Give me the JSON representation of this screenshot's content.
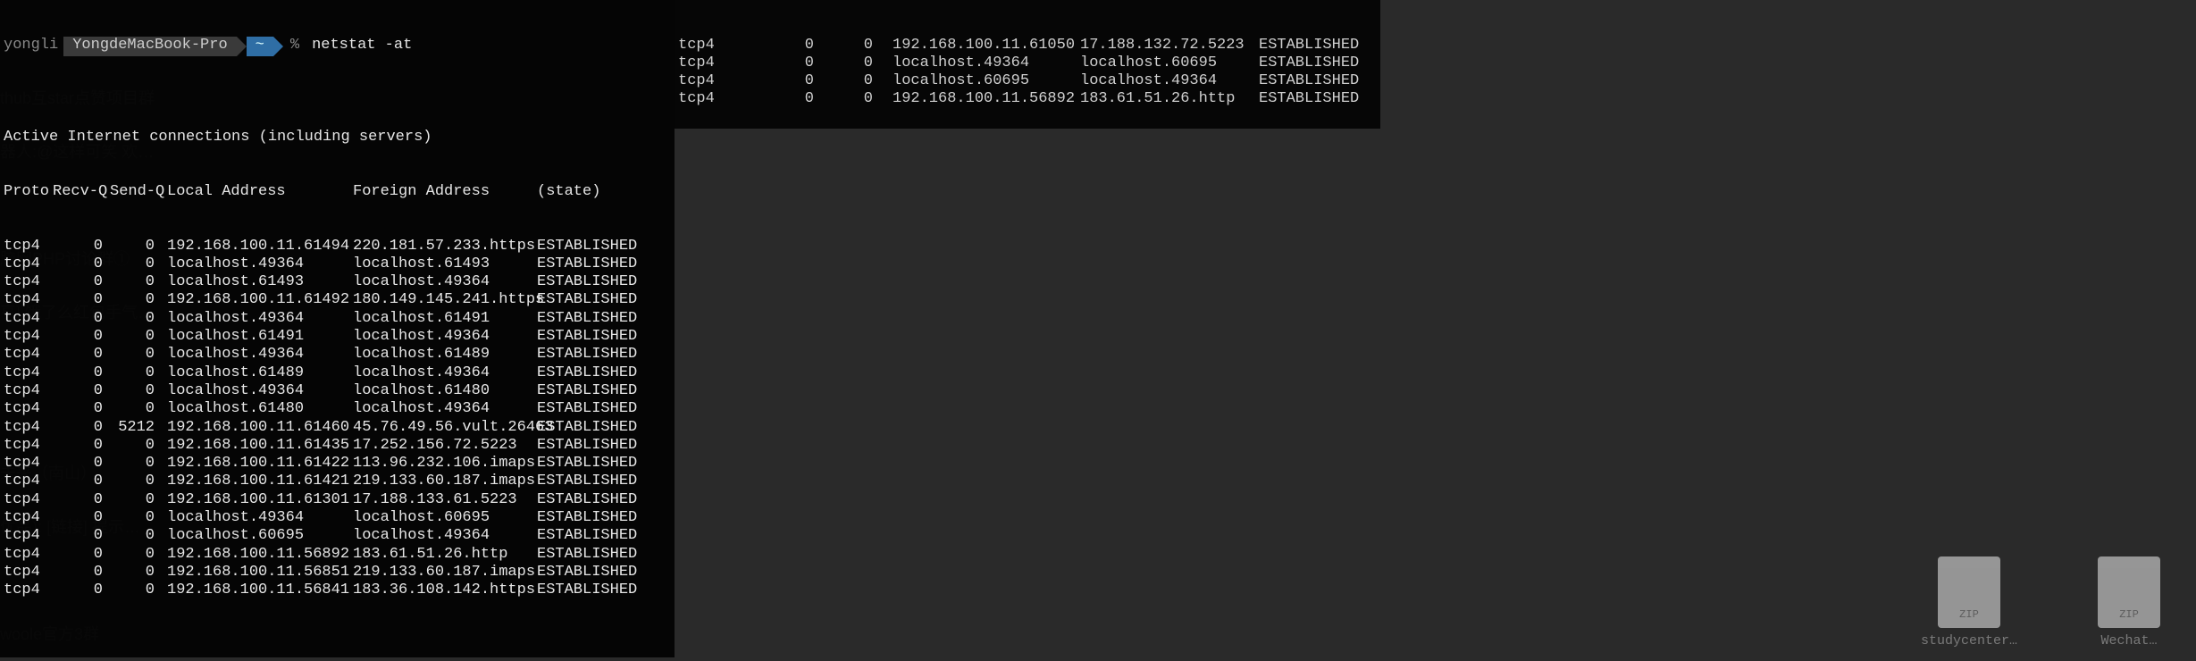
{
  "prompt": {
    "user": "yongli",
    "host": "YongdeMacBook-Pro",
    "path": "~",
    "symbol": "%",
    "command": "netstat -at"
  },
  "header_line": "Active Internet connections (including servers)",
  "columns": {
    "proto": "Proto",
    "recv": "Recv-Q",
    "send": "Send-Q",
    "local": "Local Address",
    "foreign": "Foreign Address",
    "state": "(state)"
  },
  "rows": [
    {
      "proto": "tcp4",
      "recv": "0",
      "send": "0",
      "local": "192.168.100.11.61494",
      "foreign": "220.181.57.233.https",
      "state": "ESTABLISHED"
    },
    {
      "proto": "tcp4",
      "recv": "0",
      "send": "0",
      "local": "localhost.49364",
      "foreign": "localhost.61493",
      "state": "ESTABLISHED"
    },
    {
      "proto": "tcp4",
      "recv": "0",
      "send": "0",
      "local": "localhost.61493",
      "foreign": "localhost.49364",
      "state": "ESTABLISHED"
    },
    {
      "proto": "tcp4",
      "recv": "0",
      "send": "0",
      "local": "192.168.100.11.61492",
      "foreign": "180.149.145.241.https",
      "state": "ESTABLISHED"
    },
    {
      "proto": "tcp4",
      "recv": "0",
      "send": "0",
      "local": "localhost.49364",
      "foreign": "localhost.61491",
      "state": "ESTABLISHED"
    },
    {
      "proto": "tcp4",
      "recv": "0",
      "send": "0",
      "local": "localhost.61491",
      "foreign": "localhost.49364",
      "state": "ESTABLISHED"
    },
    {
      "proto": "tcp4",
      "recv": "0",
      "send": "0",
      "local": "localhost.49364",
      "foreign": "localhost.61489",
      "state": "ESTABLISHED"
    },
    {
      "proto": "tcp4",
      "recv": "0",
      "send": "0",
      "local": "localhost.61489",
      "foreign": "localhost.49364",
      "state": "ESTABLISHED"
    },
    {
      "proto": "tcp4",
      "recv": "0",
      "send": "0",
      "local": "localhost.49364",
      "foreign": "localhost.61480",
      "state": "ESTABLISHED"
    },
    {
      "proto": "tcp4",
      "recv": "0",
      "send": "0",
      "local": "localhost.61480",
      "foreign": "localhost.49364",
      "state": "ESTABLISHED"
    },
    {
      "proto": "tcp4",
      "recv": "0",
      "send": "5212",
      "local": "192.168.100.11.61460",
      "foreign": "45.76.49.56.vult.26463",
      "state": "ESTABLISHED"
    },
    {
      "proto": "tcp4",
      "recv": "0",
      "send": "0",
      "local": "192.168.100.11.61435",
      "foreign": "17.252.156.72.5223",
      "state": "ESTABLISHED"
    },
    {
      "proto": "tcp4",
      "recv": "0",
      "send": "0",
      "local": "192.168.100.11.61422",
      "foreign": "113.96.232.106.imaps",
      "state": "ESTABLISHED"
    },
    {
      "proto": "tcp4",
      "recv": "0",
      "send": "0",
      "local": "192.168.100.11.61421",
      "foreign": "219.133.60.187.imaps",
      "state": "ESTABLISHED"
    },
    {
      "proto": "tcp4",
      "recv": "0",
      "send": "0",
      "local": "192.168.100.11.61301",
      "foreign": "17.188.133.61.5223",
      "state": "ESTABLISHED"
    },
    {
      "proto": "tcp4",
      "recv": "0",
      "send": "0",
      "local": "localhost.49364",
      "foreign": "localhost.60695",
      "state": "ESTABLISHED"
    },
    {
      "proto": "tcp4",
      "recv": "0",
      "send": "0",
      "local": "localhost.60695",
      "foreign": "localhost.49364",
      "state": "ESTABLISHED"
    },
    {
      "proto": "tcp4",
      "recv": "0",
      "send": "0",
      "local": "192.168.100.11.56892",
      "foreign": "183.61.51.26.http",
      "state": "ESTABLISHED"
    },
    {
      "proto": "tcp4",
      "recv": "0",
      "send": "0",
      "local": "192.168.100.11.56851",
      "foreign": "219.133.60.187.imaps",
      "state": "ESTABLISHED"
    },
    {
      "proto": "tcp4",
      "recv": "0",
      "send": "0",
      "local": "192.168.100.11.56841",
      "foreign": "183.36.108.142.https",
      "state": "ESTABLISHED"
    }
  ],
  "rows2": [
    {
      "proto": "tcp4",
      "recv": "0",
      "send": "0",
      "local": "192.168.100.11.61050",
      "foreign": "17.188.132.72.5223",
      "state": "ESTABLISHED"
    },
    {
      "proto": "tcp4",
      "recv": "0",
      "send": "0",
      "local": "localhost.49364",
      "foreign": "localhost.60695",
      "state": "ESTABLISHED"
    },
    {
      "proto": "tcp4",
      "recv": "0",
      "send": "0",
      "local": "localhost.60695",
      "foreign": "localhost.49364",
      "state": "ESTABLISHED"
    },
    {
      "proto": "tcp4",
      "recv": "0",
      "send": "0",
      "local": "192.168.100.11.56892",
      "foreign": "183.61.51.26.http",
      "state": "ESTABLISHED"
    }
  ],
  "bg_chat_lines": [
    "thub互star点赞项目群",
    "器人:@这样可笑 欢…",
    "",
    "脑网PHP讨论群①",
    "亨] 饿了么红包手气…",
    "",
    "",
    "未来（南山）",
    "优品): [链接] 提示…",
    "",
    "woole官方3群"
  ],
  "bg_files": [
    "studycenter…",
    "Wechat…"
  ]
}
